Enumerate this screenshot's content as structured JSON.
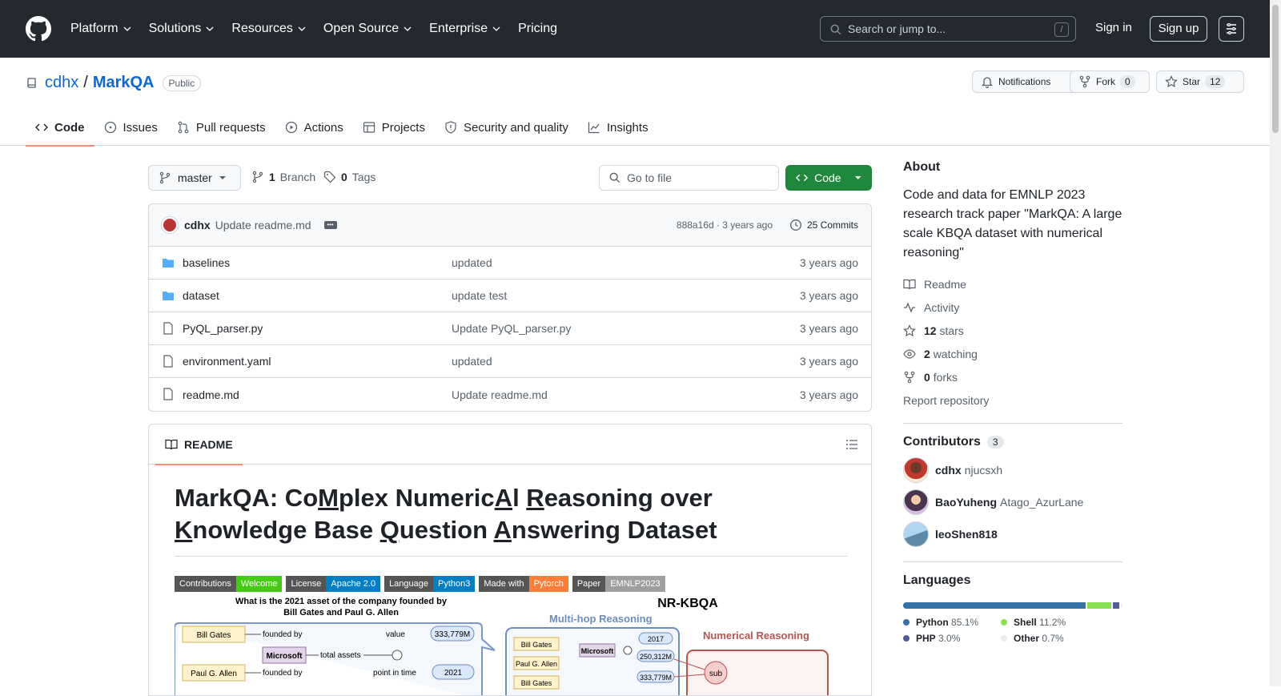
{
  "header": {
    "nav": [
      "Platform",
      "Solutions",
      "Resources",
      "Open Source",
      "Enterprise",
      "Pricing"
    ],
    "search_placeholder": "Search or jump to...",
    "search_shortcut": "/",
    "signin": "Sign in",
    "signup": "Sign up"
  },
  "repo": {
    "owner": "cdhx",
    "separator": "/",
    "name": "MarkQA",
    "visibility": "Public",
    "notifications": "Notifications",
    "fork_label": "Fork",
    "fork_count": "0",
    "star_label": "Star",
    "star_count": "12",
    "tabs": [
      "Code",
      "Issues",
      "Pull requests",
      "Actions",
      "Projects",
      "Security and quality",
      "Insights"
    ]
  },
  "toolbar": {
    "branch": "master",
    "branches_count": "1",
    "branches_label": "Branch",
    "tags_count": "0",
    "tags_label": "Tags",
    "goto_placeholder": "Go to file",
    "code_label": "Code"
  },
  "commit": {
    "author": "cdhx",
    "message": "Update readme.md",
    "hash_time": "888a16d · 3 years ago",
    "commits": "25 Commits"
  },
  "files": [
    {
      "name": "baselines",
      "type": "dir",
      "message": "updated",
      "age": "3 years ago"
    },
    {
      "name": "dataset",
      "type": "dir",
      "message": "update test",
      "age": "3 years ago"
    },
    {
      "name": "PyQL_parser.py",
      "type": "file",
      "message": "Update PyQL_parser.py",
      "age": "3 years ago"
    },
    {
      "name": "environment.yaml",
      "type": "file",
      "message": "updated",
      "age": "3 years ago"
    },
    {
      "name": "readme.md",
      "type": "file",
      "message": "Update readme.md",
      "age": "3 years ago"
    }
  ],
  "readme": {
    "tab": "README",
    "title_parts": [
      "MarkQA: Co",
      "M",
      "plex Numeric",
      "A",
      "l ",
      "R",
      "easoning over ",
      "K",
      "nowledge Base ",
      "Q",
      "uestion ",
      "A",
      "nswering Dataset"
    ],
    "badges": [
      {
        "l": "Contributions",
        "r": "Welcome",
        "color": "#4c1"
      },
      {
        "l": "License",
        "r": "Apache 2.0",
        "color": "#007ec6"
      },
      {
        "l": "Language",
        "r": "Python3",
        "color": "#007ec6"
      },
      {
        "l": "Made with",
        "r": "Pytorch",
        "color": "#fe7d37"
      },
      {
        "l": "Paper",
        "r": "EMNLP2023",
        "color": "#9f9f9f"
      }
    ],
    "figure": {
      "question_line1": "What is the 2021 asset of the company founded by",
      "question_line2": "Bill Gates and Paul G. Allen",
      "bill": "Bill Gates",
      "paul": "Paul G. Allen",
      "founded": "founded by",
      "microsoft": "Microsoft",
      "total_assets": "total assets",
      "value": "value",
      "value_num": "333,779M",
      "point_in_time": "point in time",
      "year": "2021",
      "nr_kbqa": "NR-KBQA",
      "multihop": "Multi-hop Reasoning",
      "numerical": "Numerical Reasoning",
      "y2017": "2017",
      "v250": "250,312M",
      "v333": "333,779M",
      "sub": "sub"
    }
  },
  "about": {
    "heading": "About",
    "description": "Code and data for EMNLP 2023 research track paper \"MarkQA: A large scale KBQA dataset with numerical reasoning\"",
    "readme": "Readme",
    "activity": "Activity",
    "stars_num": "12",
    "stars_label": "stars",
    "watching_num": "2",
    "watching_label": "watching",
    "forks_num": "0",
    "forks_label": "forks",
    "report": "Report repository"
  },
  "contributors": {
    "heading": "Contributors",
    "count": "3",
    "list": [
      {
        "name": "cdhx",
        "handle": "njucsxh"
      },
      {
        "name": "BaoYuheng",
        "handle": "Atago_AzurLane"
      },
      {
        "name": "leoShen818",
        "handle": ""
      }
    ]
  },
  "languages": {
    "heading": "Languages",
    "list": [
      {
        "name": "Python",
        "pct": "85.1%",
        "value": 85.1,
        "color": "#3572A5"
      },
      {
        "name": "Shell",
        "pct": "11.2%",
        "value": 11.2,
        "color": "#89e051"
      },
      {
        "name": "PHP",
        "pct": "3.0%",
        "value": 3.0,
        "color": "#4F5D95"
      },
      {
        "name": "Other",
        "pct": "0.7%",
        "value": 0.7,
        "color": "#ededed"
      }
    ]
  }
}
